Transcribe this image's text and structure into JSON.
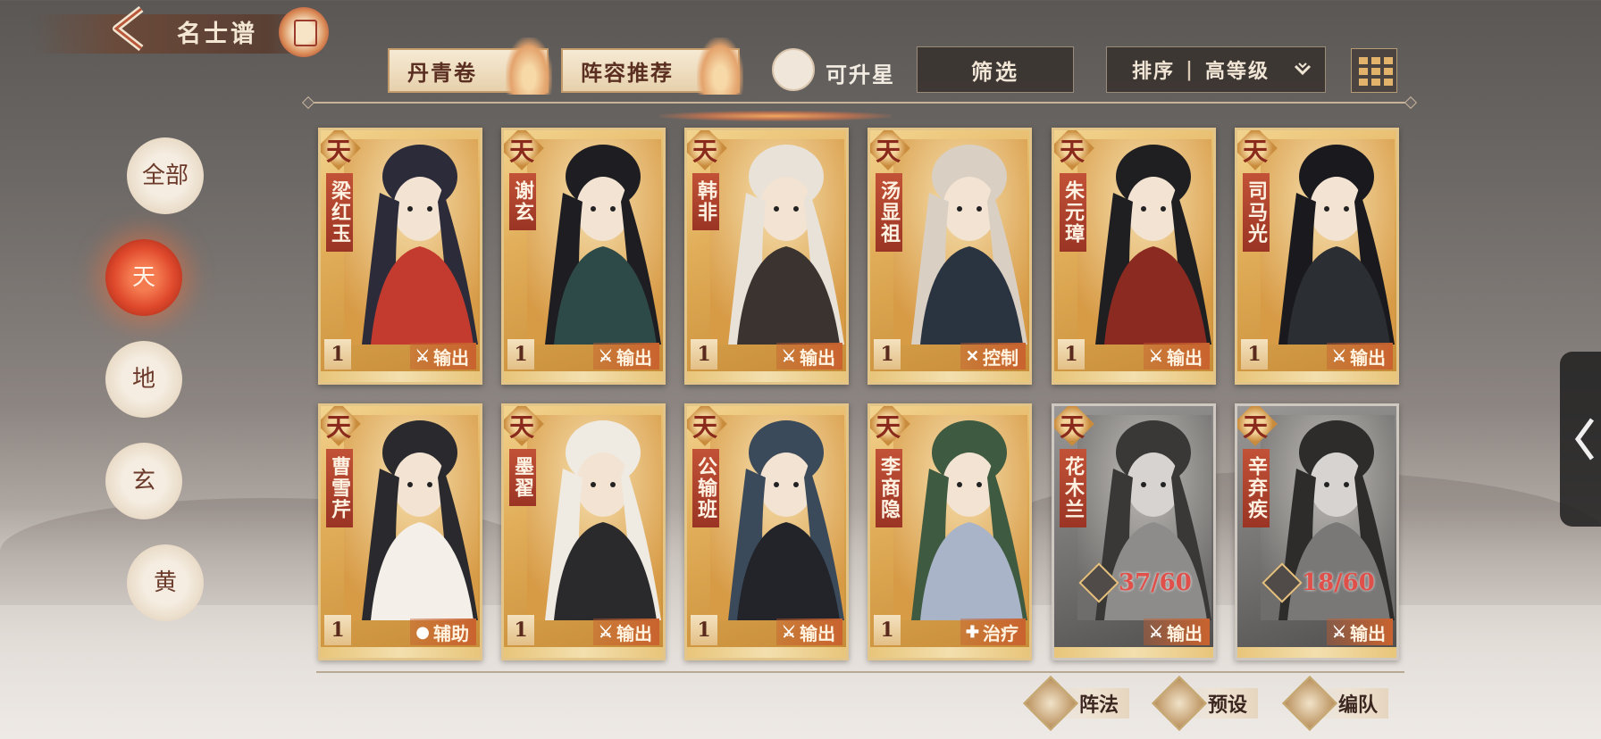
{
  "header": {
    "title": "名士谱"
  },
  "tabs": [
    {
      "label": "丹青卷"
    },
    {
      "label": "阵容推荐"
    }
  ],
  "toolbar": {
    "upgradable_label": "可升星",
    "filter_label": "筛选",
    "sort_label": "排序",
    "sort_value": "高等级"
  },
  "tiers": [
    {
      "label": "全部"
    },
    {
      "label": "天"
    },
    {
      "label": "地"
    },
    {
      "label": "玄"
    },
    {
      "label": "黄"
    }
  ],
  "cards": [
    {
      "tier": "天",
      "name": "梁红玉",
      "level": "1",
      "role": "输出",
      "role_icon": "sword-icon"
    },
    {
      "tier": "天",
      "name": "谢玄",
      "level": "1",
      "role": "输出",
      "role_icon": "sword-icon"
    },
    {
      "tier": "天",
      "name": "韩非",
      "level": "1",
      "role": "输出",
      "role_icon": "sword-icon"
    },
    {
      "tier": "天",
      "name": "汤显祖",
      "level": "1",
      "role": "控制",
      "role_icon": "control-icon"
    },
    {
      "tier": "天",
      "name": "朱元璋",
      "level": "1",
      "role": "输出",
      "role_icon": "sword-icon"
    },
    {
      "tier": "天",
      "name": "司马光",
      "level": "1",
      "role": "输出",
      "role_icon": "sword-icon"
    },
    {
      "tier": "天",
      "name": "曹雪芹",
      "level": "1",
      "role": "辅助",
      "role_icon": "support-icon"
    },
    {
      "tier": "天",
      "name": "墨翟",
      "level": "1",
      "role": "输出",
      "role_icon": "sword-icon"
    },
    {
      "tier": "天",
      "name": "公输班",
      "level": "1",
      "role": "输出",
      "role_icon": "sword-icon"
    },
    {
      "tier": "天",
      "name": "李商隐",
      "level": "1",
      "role": "治疗",
      "role_icon": "heal-icon"
    },
    {
      "tier": "天",
      "name": "花木兰",
      "fragments": "37/60",
      "role": "输出",
      "role_icon": "sword-icon"
    },
    {
      "tier": "天",
      "name": "辛弃疾",
      "fragments": "18/60",
      "role": "输出",
      "role_icon": "sword-icon"
    }
  ],
  "bottom_buttons": [
    {
      "label": "阵法"
    },
    {
      "label": "预设"
    },
    {
      "label": "编队"
    }
  ],
  "colors": {
    "accent": "#c9632f",
    "active_tier": "#e04a2d",
    "fragment_text": "#e0504a"
  }
}
